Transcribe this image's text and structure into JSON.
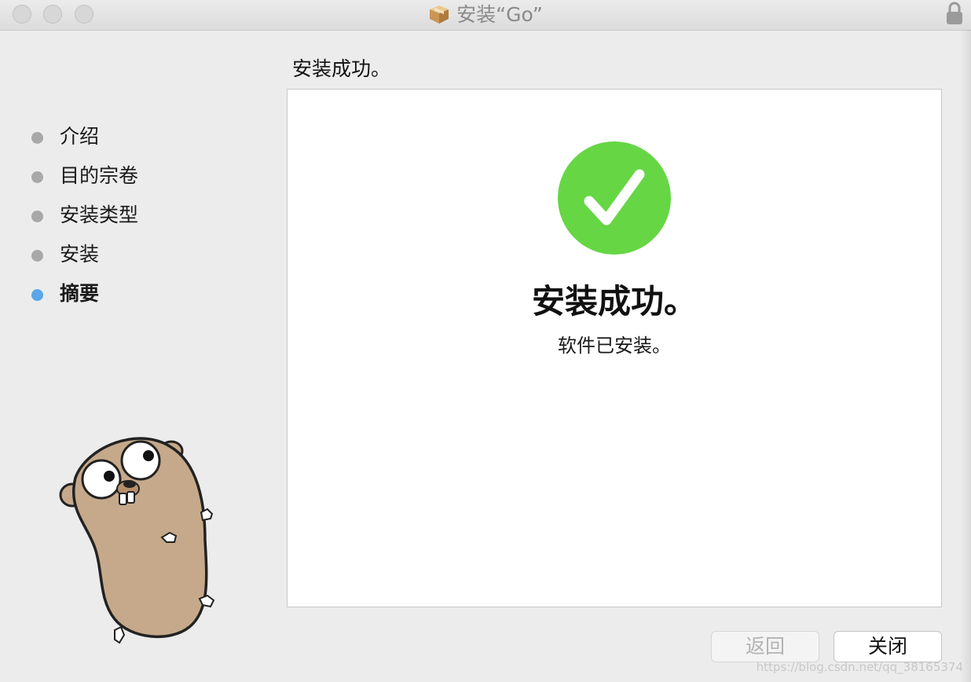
{
  "window": {
    "title": "安装“Go”"
  },
  "sidebar": {
    "steps": [
      {
        "label": "介绍",
        "state": "done"
      },
      {
        "label": "目的宗卷",
        "state": "done"
      },
      {
        "label": "安装类型",
        "state": "done"
      },
      {
        "label": "安装",
        "state": "done"
      },
      {
        "label": "摘要",
        "state": "current"
      }
    ]
  },
  "main": {
    "heading": "安装成功。",
    "success_title": "安装成功。",
    "success_subtitle": "软件已安装。"
  },
  "buttons": {
    "back_label": "返回",
    "close_label": "关闭"
  },
  "watermark": "https://blog.csdn.net/qq_38165374",
  "colors": {
    "success_green": "#66d645",
    "current_step_dot": "#5aa6e8",
    "done_step_dot": "#a8a8a8"
  },
  "icons": [
    "package-icon",
    "lock-icon",
    "checkmark-icon",
    "gopher-mascot"
  ]
}
